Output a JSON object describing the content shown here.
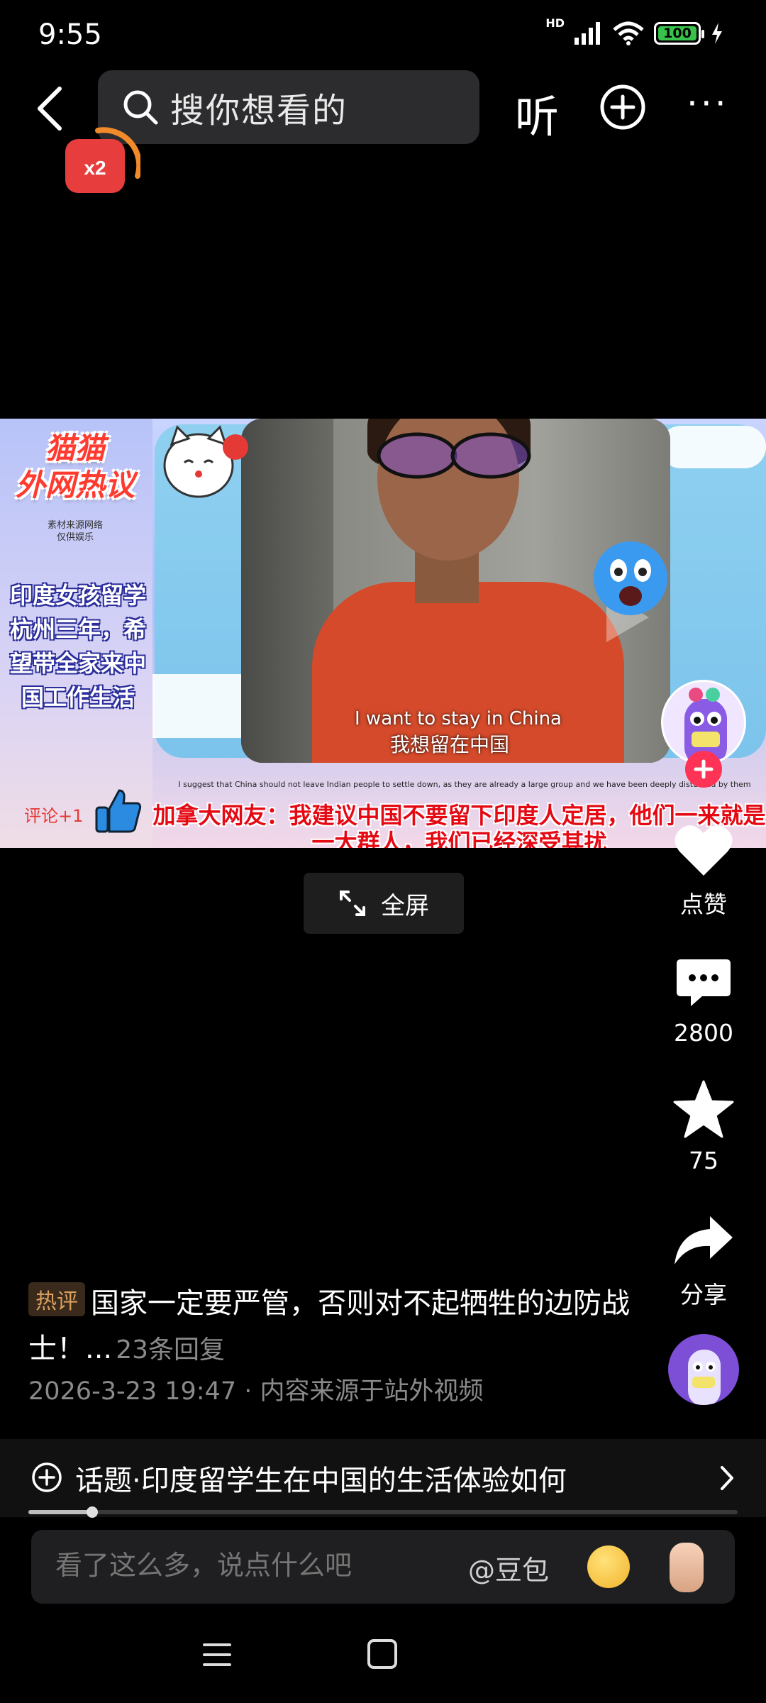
{
  "status_bar": {
    "time": "9:55",
    "network": "HD",
    "battery": "100"
  },
  "top_bar": {
    "search_placeholder": "搜你想看的",
    "listen_label": "听",
    "more_label": "···",
    "badge_label": "x2"
  },
  "video": {
    "brand_title": "猫猫\n外网热议",
    "brand_note": "素材来源网络\n仅供娱乐",
    "caption": "印度女孩留学杭州三年，希望带全家来中国工作生活",
    "subtitle_en": "I want to stay in China",
    "subtitle_zh": "我想留在中国",
    "small_english": "I suggest that China should not leave Indian people to settle down, as they are already a large group and we have been deeply disturbed by them",
    "overlay_text": "加拿大网友：我建议中国不要留下印度人定居，他们一来就是一大群人，我们已经深受其扰",
    "comment_label": "评论+1"
  },
  "fullscreen_label": "全屏",
  "actions": {
    "like_label": "点赞",
    "comment_count": "2800",
    "star_count": "75",
    "share_label": "分享"
  },
  "hot_comment": {
    "tag": "热评",
    "text": "国家一定要严管，否则对不起牺牲的边防战士！...",
    "reply_count": "23条回复"
  },
  "meta": "2026-3-23 19:47 · 内容来源于站外视频",
  "topic": "话题·印度留学生在中国的生活体验如何",
  "progress": {
    "fraction": 0.09
  },
  "comment_input": {
    "placeholder": "看了这么多，说点什么吧",
    "mention": "@豆包"
  },
  "colors": {
    "background": "#000000",
    "accent_red": "#ff3355",
    "hot_tag": "#d9a060"
  }
}
